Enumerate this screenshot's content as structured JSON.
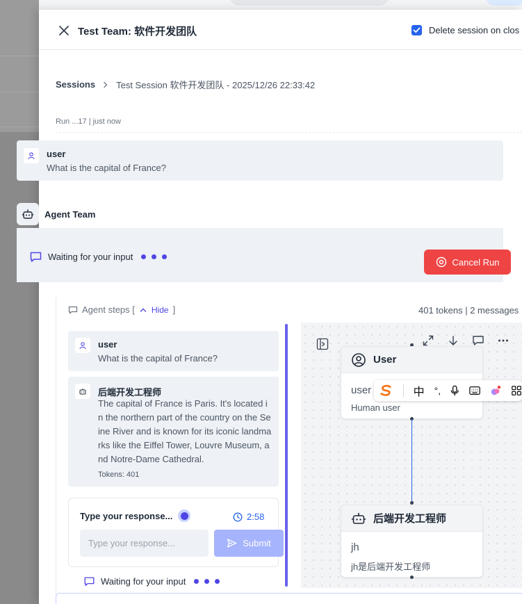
{
  "header": {
    "title": "Test Team: 软件开发团队",
    "delete_session_label": "Delete session on clos",
    "delete_session_checked": true
  },
  "breadcrumb": {
    "root": "Sessions",
    "current": "Test Session 软件开发团队 - 2025/12/26 22:33:42"
  },
  "run_info": "Run ...17 | just now",
  "user_message": {
    "role": "user",
    "text": "What is the capital of France?"
  },
  "agent_team": {
    "name": "Agent Team",
    "status": "Waiting for your input",
    "cancel_label": "Cancel Run"
  },
  "agent_steps": {
    "label": "Agent steps [",
    "toggle_label": "Hide",
    "close_bracket": "]",
    "summary": "401 tokens | 2 messages",
    "messages": [
      {
        "role": "user",
        "text": "What is the capital of France?"
      },
      {
        "role": "后端开发工程师",
        "text": "The capital of France is Paris. It's located in the northern part of the country on the Seine River and is known for its iconic landmarks like the Eiffel Tower, Louvre Museum, and Notre-Dame Cathedral.",
        "tokens": "Tokens: 401"
      }
    ]
  },
  "response_input": {
    "title": "Type your response...",
    "timer": "2:58",
    "placeholder": "Type your response...",
    "submit_label": "Submit"
  },
  "bottom_status": "Waiting for your input",
  "graph": {
    "nodes": [
      {
        "title": "User",
        "subtitle": "user",
        "description": "Human user",
        "icon": "user-circle-icon"
      },
      {
        "title": "后端开发工程师",
        "subtitle": "jh",
        "description": "jh是后端开发工程师",
        "icon": "bot-icon"
      }
    ]
  },
  "ime_toolbar": {
    "mode": "中",
    "punct": "°,"
  },
  "colors": {
    "accent": "#4f46e5",
    "danger": "#ef4444",
    "check": "#2563eb"
  }
}
